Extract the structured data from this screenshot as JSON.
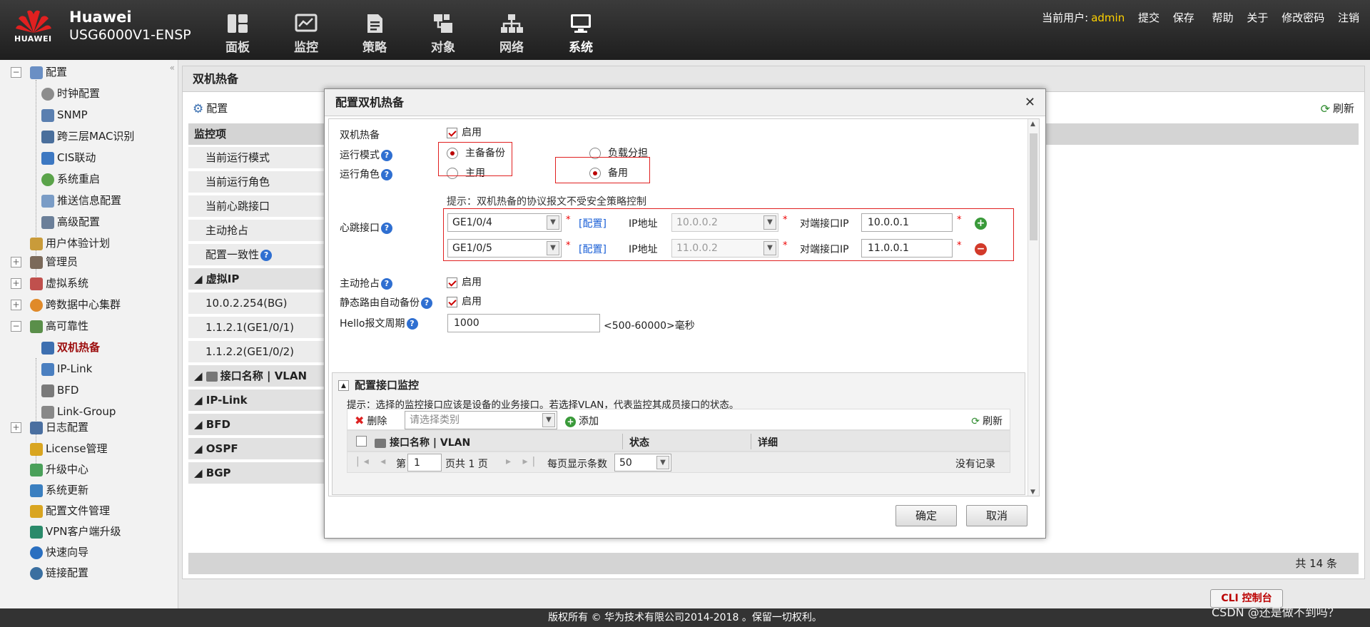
{
  "header": {
    "brand": "Huawei",
    "logo_text": "HUAWEI",
    "model": "USG6000V1-ENSP",
    "nav": [
      {
        "label": "面板",
        "icon": "dashboard-icon"
      },
      {
        "label": "监控",
        "icon": "monitor-icon"
      },
      {
        "label": "策略",
        "icon": "policy-icon"
      },
      {
        "label": "对象",
        "icon": "object-icon"
      },
      {
        "label": "网络",
        "icon": "network-icon"
      },
      {
        "label": "系统",
        "icon": "system-icon"
      }
    ],
    "user_label": "当前用户:",
    "user_name": "admin",
    "links": [
      "提交",
      "保存",
      "帮助",
      "关于",
      "修改密码",
      "注销"
    ]
  },
  "sidebar": {
    "items": [
      {
        "label": "配置",
        "icon": "config-icon",
        "color": "#6a8fc4"
      },
      {
        "label": "时钟配置",
        "icon": "clock-icon",
        "color": "#8c8c8c"
      },
      {
        "label": "SNMP",
        "icon": "snmp-icon",
        "color": "#5a7fb0"
      },
      {
        "label": "跨三层MAC识别",
        "icon": "mac-icon",
        "color": "#4a6f9c"
      },
      {
        "label": "CIS联动",
        "icon": "shield-icon",
        "color": "#3d78c2"
      },
      {
        "label": "系统重启",
        "icon": "restart-icon",
        "color": "#5aa34a"
      },
      {
        "label": "推送信息配置",
        "icon": "push-icon",
        "color": "#7a9cc6"
      },
      {
        "label": "高级配置",
        "icon": "advanced-icon",
        "color": "#6b7f99"
      },
      {
        "label": "用户体验计划",
        "icon": "user-experience-icon",
        "color": "#c99b3a"
      },
      {
        "label": "管理员",
        "icon": "admin-icon",
        "color": "#7b6a5a"
      },
      {
        "label": "虚拟系统",
        "icon": "virtual-system-icon",
        "color": "#c0504d"
      },
      {
        "label": "跨数据中心集群",
        "icon": "cluster-icon",
        "color": "#e08a2a"
      },
      {
        "label": "高可靠性",
        "icon": "reliability-icon",
        "color": "#5a8f4a"
      },
      {
        "label": "双机热备",
        "icon": "hot-standby-icon",
        "color": "#3d6fb0"
      },
      {
        "label": "IP-Link",
        "icon": "ip-link-icon",
        "color": "#4a7fc0"
      },
      {
        "label": "BFD",
        "icon": "bfd-icon",
        "color": "#7a7a7a"
      },
      {
        "label": "Link-Group",
        "icon": "link-group-icon",
        "color": "#888888"
      },
      {
        "label": "日志配置",
        "icon": "log-icon",
        "color": "#4a6fa0"
      },
      {
        "label": "License管理",
        "icon": "license-icon",
        "color": "#d9a520"
      },
      {
        "label": "升级中心",
        "icon": "upgrade-icon",
        "color": "#4aa05a"
      },
      {
        "label": "系统更新",
        "icon": "update-icon",
        "color": "#3a7fc0"
      },
      {
        "label": "配置文件管理",
        "icon": "file-icon",
        "color": "#d9a520"
      },
      {
        "label": "VPN客户端升级",
        "icon": "vpn-icon",
        "color": "#2a8a6a"
      },
      {
        "label": "快速向导",
        "icon": "wizard-icon",
        "color": "#2a6fc0"
      },
      {
        "label": "链接配置",
        "icon": "link-config-icon",
        "color": "#3a6fa0"
      }
    ]
  },
  "main": {
    "title": "双机热备",
    "config_label": "配置",
    "refresh_label": "刷新",
    "monitor_header": "监控项",
    "rows": [
      "当前运行模式",
      "当前运行角色",
      "当前心跳接口",
      "主动抢占",
      "配置一致性",
      "虚拟IP",
      "10.0.2.254(BG)",
      "1.1.2.1(GE1/0/1)",
      "1.1.2.2(GE1/0/2)",
      "接口名称 | VLAN",
      "IP-Link",
      "BFD",
      "OSPF",
      "BGP"
    ],
    "total": "共 14 条"
  },
  "dialog": {
    "title": "配置双机热备",
    "hot_standby_label": "双机热备",
    "enable_label": "启用",
    "mode_label": "运行模式",
    "mode_active": "主备备份",
    "mode_load": "负载分担",
    "role_label": "运行角色",
    "role_primary": "主用",
    "role_backup": "备用",
    "hint": "提示：双机热备的协议报文不受安全策略控制",
    "heartbeat_label": "心跳接口",
    "hb": [
      {
        "iface": "GE1/0/4",
        "config": "[配置]",
        "ip_label": "IP地址",
        "ip": "10.0.0.2",
        "peer_label": "对端接口IP",
        "peer": "10.0.0.1"
      },
      {
        "iface": "GE1/0/5",
        "config": "[配置]",
        "ip_label": "IP地址",
        "ip": "11.0.0.2",
        "peer_label": "对端接口IP",
        "peer": "11.0.0.1"
      }
    ],
    "preempt_label": "主动抢占",
    "static_backup_label": "静态路由自动备份",
    "hello_label": "Hello报文周期",
    "hello_value": "1000",
    "hello_range": "<500-60000>毫秒",
    "iface_monitor": {
      "title": "配置接口监控",
      "hint": "提示：选择的监控接口应该是设备的业务接口。若选择VLAN，代表监控其成员接口的状态。",
      "delete": "删除",
      "select_placeholder": "请选择类别",
      "add": "添加",
      "refresh": "刷新",
      "col_iface": "接口名称 | VLAN",
      "col_status": "状态",
      "col_detail": "详细",
      "page_prefix": "第",
      "page_value": "1",
      "page_suffix": "页共 1 页",
      "per_page_label": "每页显示条数",
      "per_page": "50",
      "no_records": "没有记录"
    },
    "ok": "确定",
    "cancel": "取消"
  },
  "footer": {
    "copyright": "版权所有 © 华为技术有限公司2014-2018 。保留一切权利。",
    "cli": "CLI 控制台",
    "watermark": "CSDN @还是做不到吗？"
  }
}
